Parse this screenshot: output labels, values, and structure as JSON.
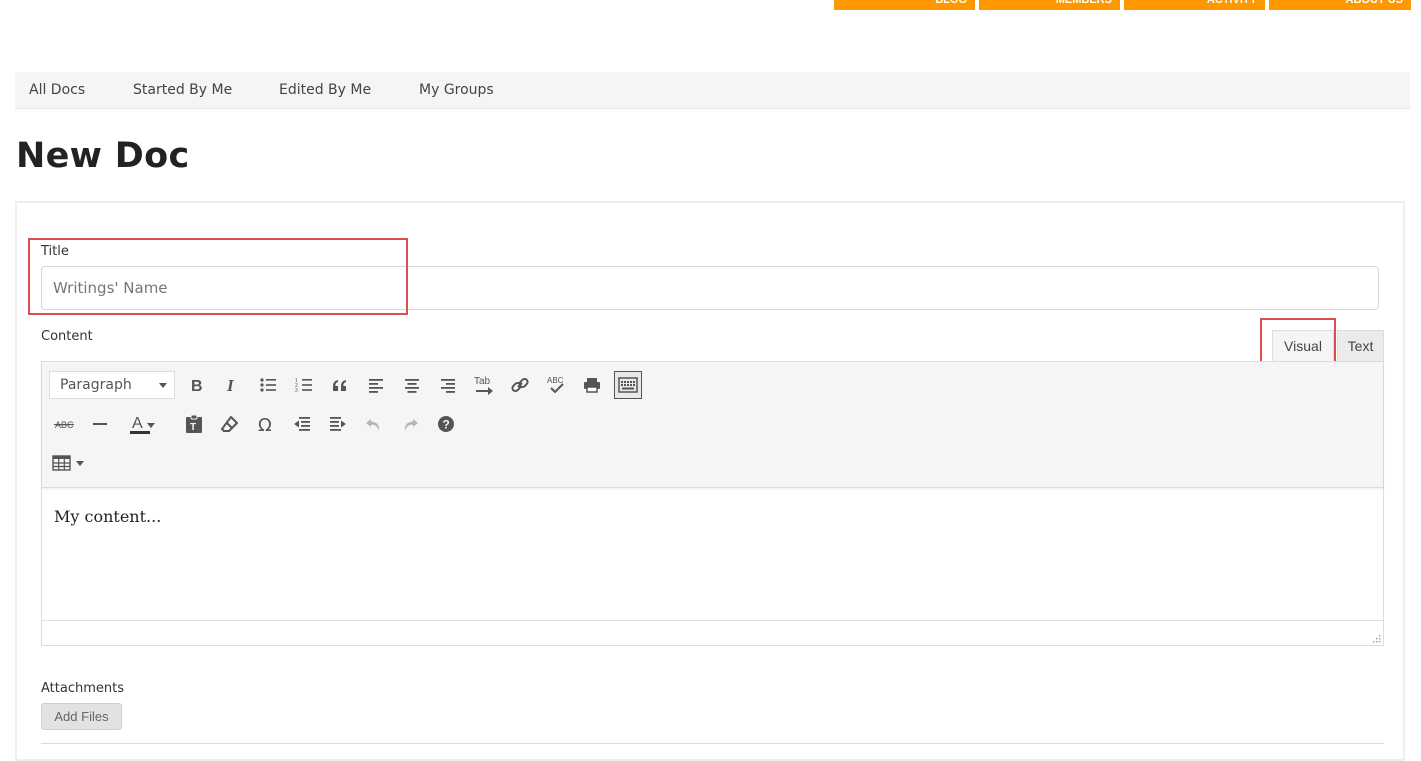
{
  "top_nav": {
    "items": [
      "BLOG",
      "MEMBERS",
      "ACTIVITY",
      "ABOUT US"
    ],
    "color": "#ff9800"
  },
  "sub_nav": {
    "items": [
      "All Docs",
      "Started By Me",
      "Edited By Me",
      "My Groups"
    ]
  },
  "page": {
    "title": "New Doc"
  },
  "form": {
    "title_label": "Title",
    "title_placeholder": "Writings' Name",
    "content_label": "Content",
    "mode_tabs": {
      "visual": "Visual",
      "text": "Text"
    },
    "active_mode": "Visual",
    "format_select": {
      "value": "Paragraph"
    },
    "toolbar_icons": [
      "bold-icon",
      "italic-icon",
      "bulleted-list-icon",
      "numbered-list-icon",
      "blockquote-icon",
      "align-left-icon",
      "align-center-icon",
      "align-right-icon",
      "tab-icon",
      "link-icon",
      "spellcheck-icon",
      "print-icon",
      "toolbar-toggle-icon",
      "strikethrough-icon",
      "horizontal-line-icon",
      "text-color-icon",
      "paste-text-icon",
      "clear-formatting-icon",
      "special-character-icon",
      "outdent-icon",
      "indent-icon",
      "undo-icon",
      "redo-icon",
      "help-icon",
      "table-icon"
    ],
    "content_value": "My content...",
    "attachments_label": "Attachments",
    "add_files_label": "Add Files"
  },
  "highlight_color": "#d9504c"
}
